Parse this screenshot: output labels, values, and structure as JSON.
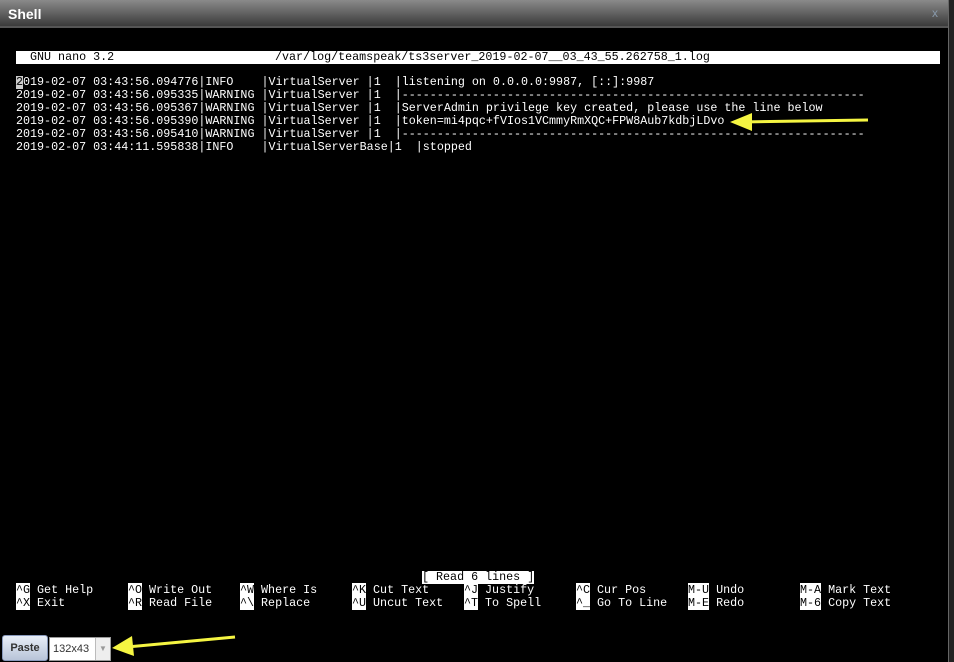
{
  "window": {
    "title": "Shell",
    "close": "x"
  },
  "nano": {
    "app": "GNU nano 3.2",
    "file": "/var/log/teamspeak/ts3server_2019-02-07__03_43_55.262758_1.log"
  },
  "log_lines": [
    "2019-02-07 03:43:56.094776|INFO    |VirtualServer |1  |listening on 0.0.0.0:9987, [::]:9987",
    "2019-02-07 03:43:56.095335|WARNING |VirtualServer |1  |------------------------------------------------------------------",
    "2019-02-07 03:43:56.095367|WARNING |VirtualServer |1  |ServerAdmin privilege key created, please use the line below",
    "2019-02-07 03:43:56.095390|WARNING |VirtualServer |1  |token=mi4pqc+fVIos1VCmmyRmXQC+FPW8Aub7kdbjLDvo",
    "2019-02-07 03:43:56.095410|WARNING |VirtualServer |1  |------------------------------------------------------------------",
    "2019-02-07 03:44:11.595838|INFO    |VirtualServerBase|1  |stopped"
  ],
  "status": "[ Read 6 lines ]",
  "shortcuts": [
    {
      "key": "^G",
      "label": "Get Help"
    },
    {
      "key": "^O",
      "label": "Write Out"
    },
    {
      "key": "^W",
      "label": "Where Is"
    },
    {
      "key": "^K",
      "label": "Cut Text"
    },
    {
      "key": "^J",
      "label": "Justify"
    },
    {
      "key": "^C",
      "label": "Cur Pos"
    },
    {
      "key": "M-U",
      "label": "Undo"
    },
    {
      "key": "M-A",
      "label": "Mark Text"
    },
    {
      "key": "^X",
      "label": "Exit"
    },
    {
      "key": "^R",
      "label": "Read File"
    },
    {
      "key": "^\\",
      "label": "Replace"
    },
    {
      "key": "^U",
      "label": "Uncut Text"
    },
    {
      "key": "^T",
      "label": "To Spell"
    },
    {
      "key": "^_",
      "label": "Go To Line"
    },
    {
      "key": "M-E",
      "label": "Redo"
    },
    {
      "key": "M-6",
      "label": "Copy Text"
    }
  ],
  "toolbar": {
    "paste": "Paste",
    "size": "132x43"
  },
  "colors": {
    "arrow": "#f5f542"
  }
}
